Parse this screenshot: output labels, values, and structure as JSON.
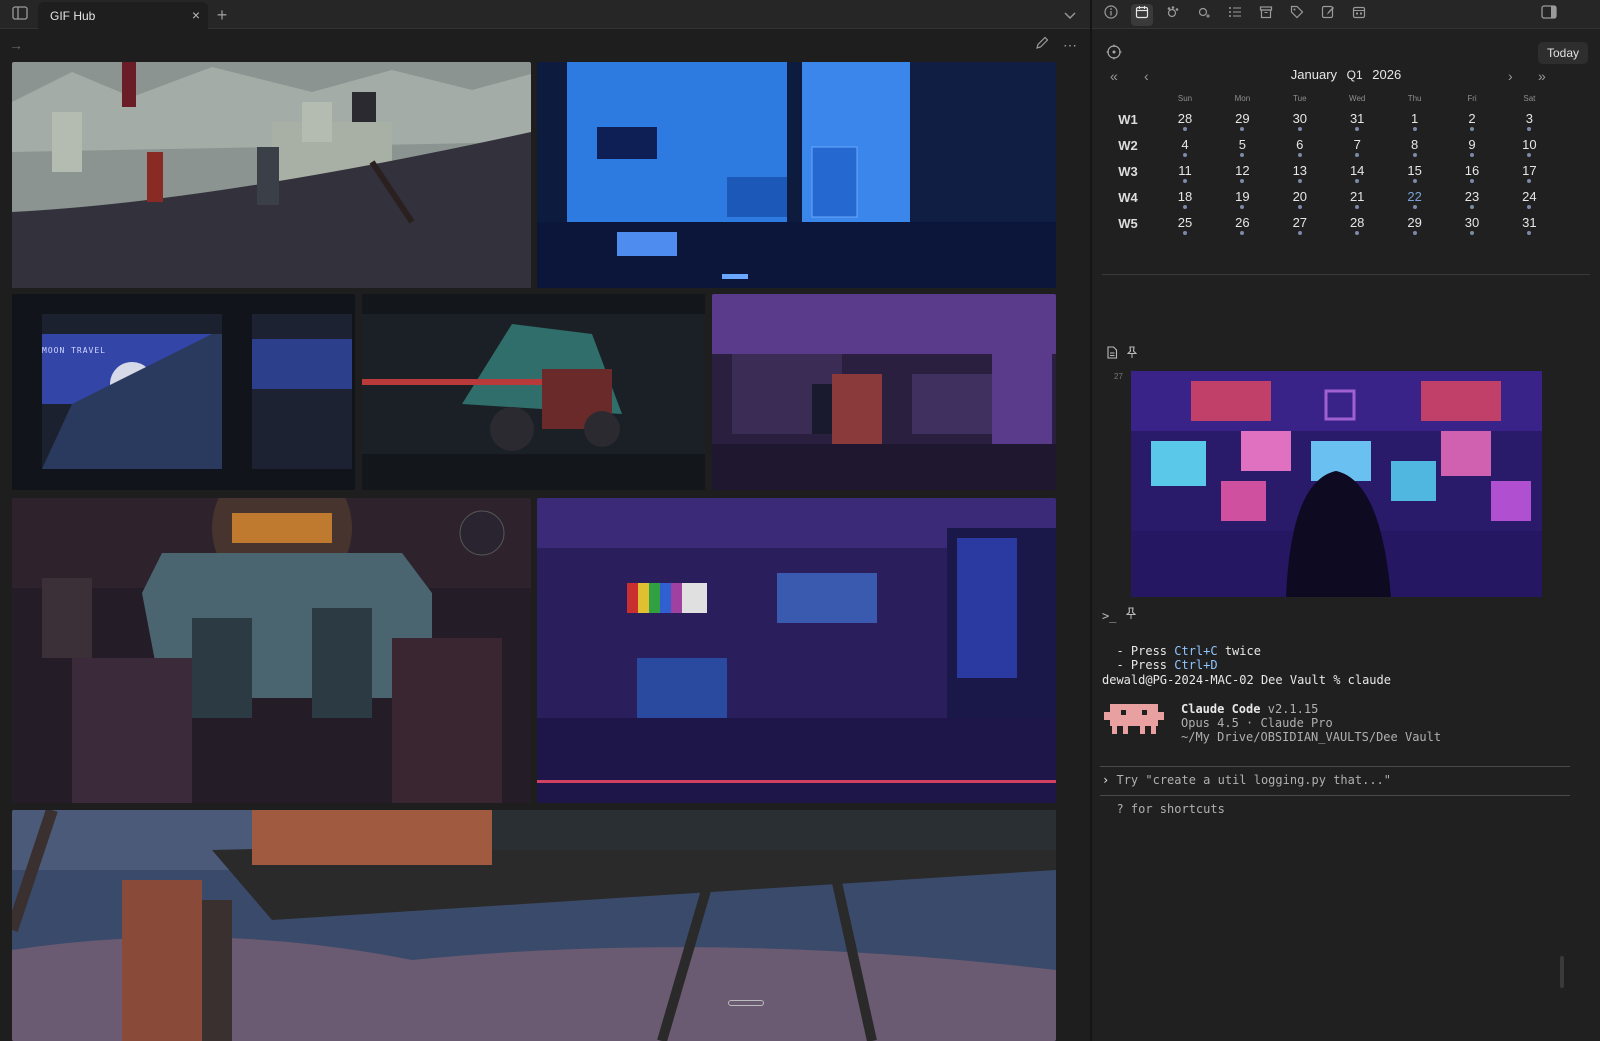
{
  "tabbar": {
    "tab_title": "GIF Hub",
    "close_glyph": "×",
    "new_tab_glyph": "+",
    "sidebar_icon": "sidebar-toggle-icon",
    "chevron": "⌄"
  },
  "navbar": {
    "forward_glyph": "→",
    "edit_icon": "pencil-icon",
    "more_glyph": "⋯"
  },
  "gallery": {
    "tiles": [
      {
        "name": "castle-knights-gif"
      },
      {
        "name": "blue-room-gif"
      },
      {
        "name": "moon-travel-train-gif",
        "caption": "MOON TRAVEL"
      },
      {
        "name": "motorcycle-rider-gif"
      },
      {
        "name": "studio-workspace-gif"
      },
      {
        "name": "rainy-cafe-gif"
      },
      {
        "name": "neon-bar-gif"
      },
      {
        "name": "sky-platform-gif"
      }
    ]
  },
  "right_toolbar": {
    "icons": [
      "info-icon",
      "calendar-icon",
      "paw-icon",
      "paw-plus-icon",
      "list-icon",
      "archive-icon",
      "tag-icon",
      "note-edit-icon",
      "calendar-grid-icon"
    ],
    "panel_icon": "right-sidebar-icon"
  },
  "calendar": {
    "today_label": "Today",
    "month": "January",
    "quarter": "Q1",
    "year": "2026",
    "weekdays": [
      "Sun",
      "Mon",
      "Tue",
      "Wed",
      "Thu",
      "Fri",
      "Sat"
    ],
    "weeks": [
      {
        "label": "W1",
        "days": [
          "28",
          "29",
          "30",
          "31",
          "1",
          "2",
          "3"
        ]
      },
      {
        "label": "W2",
        "days": [
          "4",
          "5",
          "6",
          "7",
          "8",
          "9",
          "10"
        ]
      },
      {
        "label": "W3",
        "days": [
          "11",
          "12",
          "13",
          "14",
          "15",
          "16",
          "17"
        ]
      },
      {
        "label": "W4",
        "days": [
          "18",
          "19",
          "20",
          "21",
          "22",
          "23",
          "24"
        ]
      },
      {
        "label": "W5",
        "days": [
          "25",
          "26",
          "27",
          "28",
          "29",
          "30",
          "31"
        ]
      }
    ],
    "today_day": "22"
  },
  "embed": {
    "line_number": "27"
  },
  "terminal": {
    "l1_prefix": "  - Press ",
    "l1_key": "Ctrl+C",
    "l1_suffix": " twice",
    "l2_prefix": "  - Press ",
    "l2_key": "Ctrl+D",
    "prompt_line": "dewald@PG-2024-MAC-02 Dee Vault % claude",
    "app_name": "Claude Code",
    "version": "v2.1.15",
    "model_line": "Opus 4.5 · Claude Pro",
    "path_line": "~/My Drive/OBSIDIAN_VAULTS/Dee Vault",
    "input_placeholder": "Try \"create a util logging.py that...\"",
    "prompt_glyph": "›",
    "hint": "  ? for shortcuts"
  },
  "colors": {
    "accent_today": "#7aa2d8",
    "terminal_key": "#8fc4ff",
    "claude_pink": "#e8a0a0"
  }
}
